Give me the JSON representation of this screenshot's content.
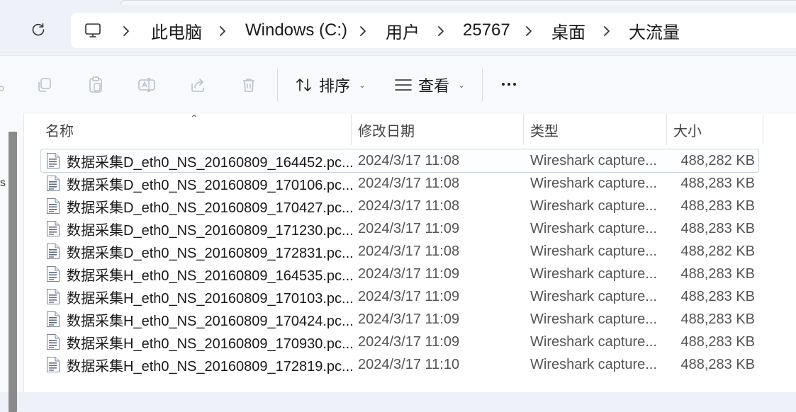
{
  "breadcrumb": {
    "root_icon": "computer-icon",
    "items": [
      "此电脑",
      "Windows (C:)",
      "用户",
      "25767",
      "桌面",
      "大流量"
    ]
  },
  "commands": {
    "sort_label": "排序",
    "view_label": "查看",
    "more_label": "..."
  },
  "columns": {
    "name": "名称",
    "date": "修改日期",
    "type": "类型",
    "size": "大小"
  },
  "nav": {
    "partial_text": "s"
  },
  "files": [
    {
      "name": "数据采集D_eth0_NS_20160809_164452.pc...",
      "date": "2024/3/17 11:08",
      "type": "Wireshark capture...",
      "size": "488,282 KB"
    },
    {
      "name": "数据采集D_eth0_NS_20160809_170106.pc...",
      "date": "2024/3/17 11:08",
      "type": "Wireshark capture...",
      "size": "488,283 KB"
    },
    {
      "name": "数据采集D_eth0_NS_20160809_170427.pc...",
      "date": "2024/3/17 11:08",
      "type": "Wireshark capture...",
      "size": "488,283 KB"
    },
    {
      "name": "数据采集D_eth0_NS_20160809_171230.pc...",
      "date": "2024/3/17 11:09",
      "type": "Wireshark capture...",
      "size": "488,283 KB"
    },
    {
      "name": "数据采集D_eth0_NS_20160809_172831.pc...",
      "date": "2024/3/17 11:08",
      "type": "Wireshark capture...",
      "size": "488,282 KB"
    },
    {
      "name": "数据采集H_eth0_NS_20160809_164535.pc...",
      "date": "2024/3/17 11:09",
      "type": "Wireshark capture...",
      "size": "488,283 KB"
    },
    {
      "name": "数据采集H_eth0_NS_20160809_170103.pc...",
      "date": "2024/3/17 11:09",
      "type": "Wireshark capture...",
      "size": "488,283 KB"
    },
    {
      "name": "数据采集H_eth0_NS_20160809_170424.pc...",
      "date": "2024/3/17 11:09",
      "type": "Wireshark capture...",
      "size": "488,283 KB"
    },
    {
      "name": "数据采集H_eth0_NS_20160809_170930.pc...",
      "date": "2024/3/17 11:09",
      "type": "Wireshark capture...",
      "size": "488,283 KB"
    },
    {
      "name": "数据采集H_eth0_NS_20160809_172819.pc...",
      "date": "2024/3/17 11:10",
      "type": "Wireshark capture...",
      "size": "488,283 KB"
    }
  ]
}
